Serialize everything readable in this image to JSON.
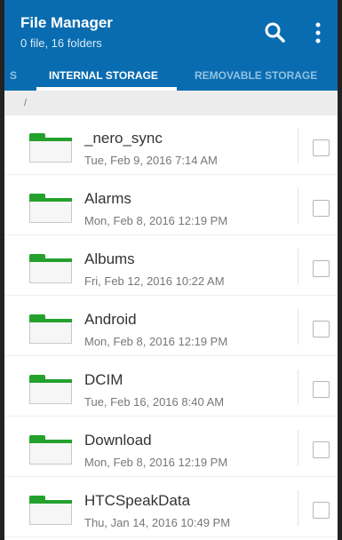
{
  "app": {
    "title": "File Manager",
    "subtitle": "0 file, 16 folders",
    "accent": "#0a6cb0"
  },
  "toolbar": {
    "search_icon": "search-icon",
    "more_icon": "more-vert-icon"
  },
  "tabs": [
    {
      "label": "S",
      "active": false
    },
    {
      "label": "INTERNAL STORAGE",
      "active": true
    },
    {
      "label": "REMOVABLE STORAGE",
      "active": false
    }
  ],
  "path": "/",
  "folders": [
    {
      "name": "_nero_sync",
      "date": "Tue, Feb 9, 2016 7:14 AM",
      "checked": false
    },
    {
      "name": "Alarms",
      "date": "Mon, Feb 8, 2016 12:19 PM",
      "checked": false
    },
    {
      "name": "Albums",
      "date": "Fri, Feb 12, 2016 10:22 AM",
      "checked": false
    },
    {
      "name": "Android",
      "date": "Mon, Feb 8, 2016 12:19 PM",
      "checked": false
    },
    {
      "name": "DCIM",
      "date": "Tue, Feb 16, 2016 8:40 AM",
      "checked": false
    },
    {
      "name": "Download",
      "date": "Mon, Feb 8, 2016 12:19 PM",
      "checked": false
    },
    {
      "name": "HTCSpeakData",
      "date": "Thu, Jan 14, 2016 10:49 PM",
      "checked": false
    }
  ],
  "colors": {
    "folder_green": "#23a12c"
  }
}
